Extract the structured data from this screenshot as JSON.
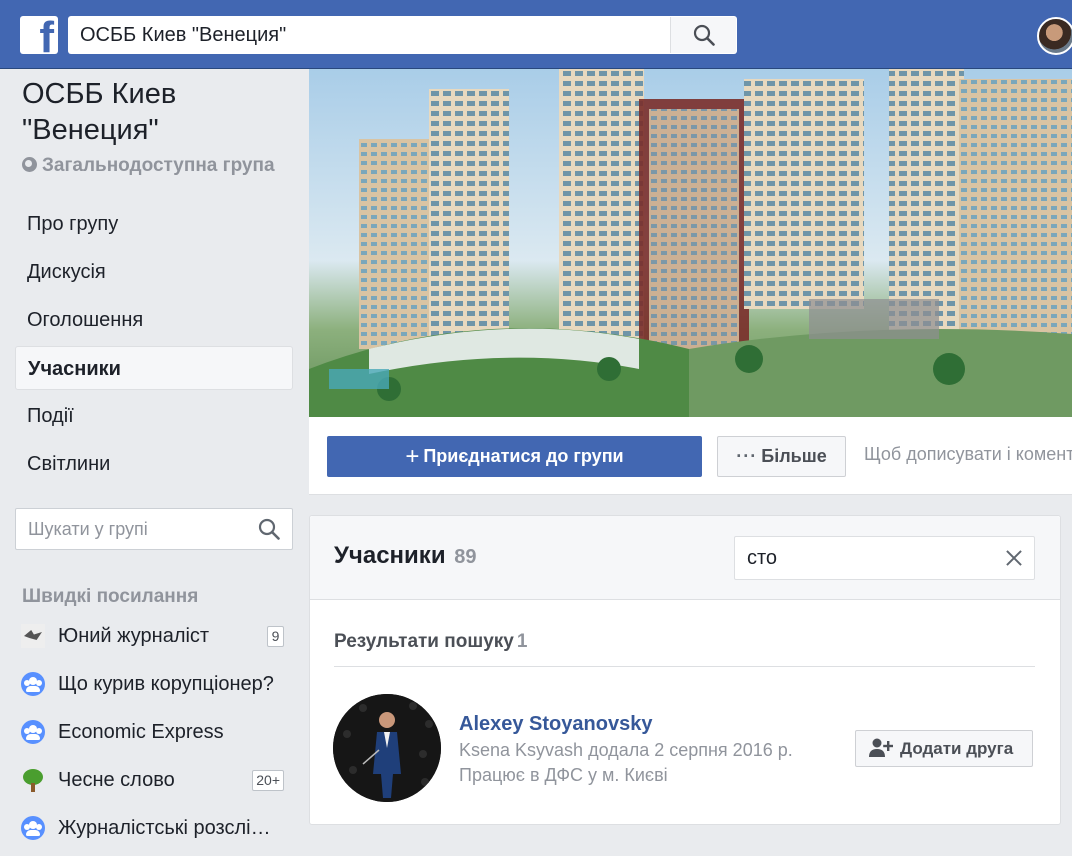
{
  "topbar": {
    "logo_letter": "f",
    "search_value": "ОСББ Киев \"Венеция\""
  },
  "group": {
    "name": "ОСББ Киев \"Венеция\"",
    "privacy": "Загальнодоступна група"
  },
  "nav": {
    "items": [
      {
        "label": "Про групу"
      },
      {
        "label": "Дискусія"
      },
      {
        "label": "Оголошення"
      },
      {
        "label": "Учасники",
        "active": true
      },
      {
        "label": "Події"
      },
      {
        "label": "Світлини"
      }
    ]
  },
  "group_search": {
    "placeholder": "Шукати у групі"
  },
  "quick_links": {
    "title": "Швидкі посилання",
    "items": [
      {
        "label": "Юний журналіст",
        "count": "9",
        "icon": "bird-icon"
      },
      {
        "label": "Що курив корупціонер?",
        "icon": "group-icon"
      },
      {
        "label": "Economic Express",
        "icon": "group-icon"
      },
      {
        "label": "Чесне слово",
        "count": "20+",
        "icon": "tree-icon"
      },
      {
        "label": "Журналістські розслід…",
        "icon": "group-icon"
      }
    ]
  },
  "actions": {
    "join_label": "Приєднатися до групи",
    "more_label": "Більше",
    "info_text": "Щоб дописувати і комент"
  },
  "members": {
    "title": "Учасники",
    "count": "89",
    "search_value": "сто",
    "results_title": "Результати пошуку",
    "results_count": "1",
    "result": {
      "name": "Alexey Stoyanovsky",
      "added_by": "Ksena Ksyvash додала 2 серпня 2016 р.",
      "work": "Працює в ДФС у м. Києві",
      "add_friend_label": "Додати друга"
    }
  },
  "colors": {
    "brand_blue": "#4267b2",
    "link_blue": "#365899",
    "page_bg": "#e9ebee"
  }
}
